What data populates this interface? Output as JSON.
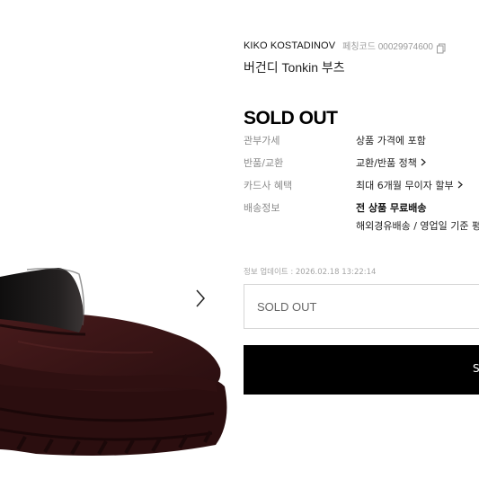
{
  "product": {
    "brand": "KIKO KOSTADINOV",
    "code_label": "페칭코드 00029974600",
    "title": "버건디 Tonkin 부츠",
    "status": "SOLD OUT"
  },
  "info": {
    "rows": [
      {
        "label": "관부가세",
        "value": "상품 가격에 포함"
      },
      {
        "label": "반품/교환",
        "value": "교환/반품 정책"
      },
      {
        "label": "카드사 혜택",
        "value": "최대 6개월 무이자 할부"
      },
      {
        "label": "배송정보",
        "value": "전 상품 무료배송",
        "value2": "해외경유배송 / 영업일 기준 평"
      }
    ]
  },
  "update_text": "정보 업데이트 : 2026.02.18 13:22:14",
  "option": {
    "text": "SOLD OUT"
  },
  "buy_button": {
    "label": "S"
  },
  "icons": {
    "copy": "copy-icon",
    "gallery_next": "chevron-right-icon",
    "policy": "chevron-right-icon"
  },
  "colors": {
    "boot_leather": "#3b1617",
    "boot_dark": "#210c0d",
    "strap": "#161414",
    "button_bg": "#000000",
    "muted_text": "#8b8b8b"
  }
}
